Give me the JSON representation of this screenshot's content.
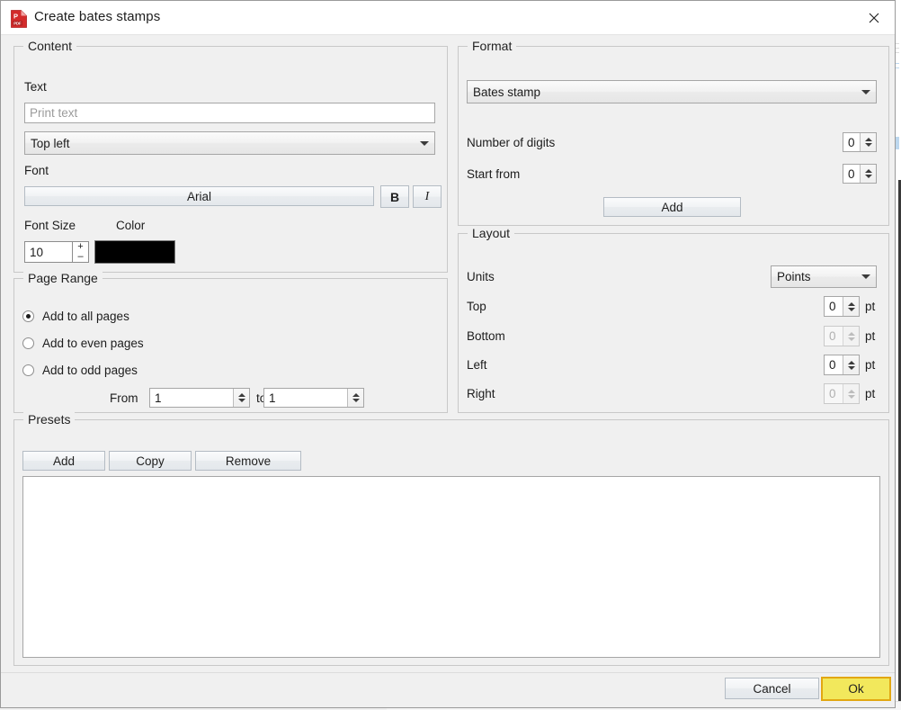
{
  "window": {
    "title": "Create bates stamps",
    "app_icon": "pdf-document-icon",
    "close_icon": "close-icon"
  },
  "content": {
    "legend": "Content",
    "text_label": "Text",
    "text_placeholder": "Print text",
    "text_value": "",
    "position_value": "Top left",
    "font_label": "Font",
    "font_value": "Arial",
    "bold_label": "B",
    "italic_label": "I",
    "font_size_label": "Font Size",
    "font_size_value": "10",
    "plus_label": "+",
    "minus_label": "–",
    "color_label": "Color",
    "color_value": "#000000"
  },
  "page_range": {
    "legend": "Page Range",
    "options": [
      {
        "label": "Add to all pages",
        "selected": true
      },
      {
        "label": "Add to even pages",
        "selected": false
      },
      {
        "label": "Add to odd pages",
        "selected": false
      }
    ],
    "from_label": "From",
    "from_value": "1",
    "to_label": "to",
    "to_value": "1"
  },
  "format": {
    "legend": "Format",
    "stamp_type_value": "Bates stamp",
    "number_of_digits_label": "Number of digits",
    "number_of_digits_value": "0",
    "start_from_label": "Start from",
    "start_from_value": "0",
    "add_label": "Add"
  },
  "layout": {
    "legend": "Layout",
    "units_label": "Units",
    "units_value": "Points",
    "rows": [
      {
        "label": "Top",
        "value": "0",
        "unit": "pt",
        "disabled": false
      },
      {
        "label": "Bottom",
        "value": "0",
        "unit": "pt",
        "disabled": true
      },
      {
        "label": "Left",
        "value": "0",
        "unit": "pt",
        "disabled": false
      },
      {
        "label": "Right",
        "value": "0",
        "unit": "pt",
        "disabled": true
      }
    ]
  },
  "presets": {
    "legend": "Presets",
    "add_label": "Add",
    "copy_label": "Copy",
    "remove_label": "Remove",
    "items": []
  },
  "footer": {
    "cancel_label": "Cancel",
    "ok_label": "Ok",
    "ok_accent": "#f2e85c",
    "ok_border": "#e2a712"
  }
}
